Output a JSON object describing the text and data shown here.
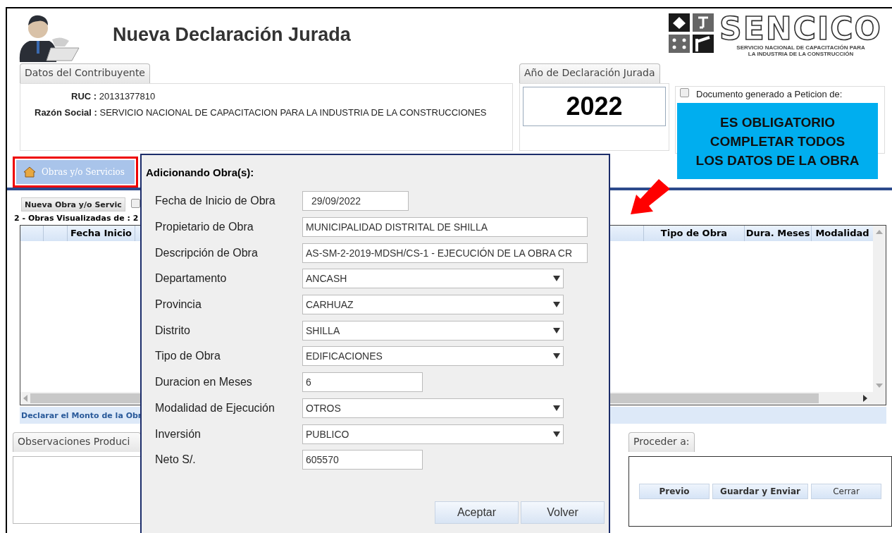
{
  "header": {
    "title": "Nueva Declaración Jurada",
    "logo": {
      "name": "SENCICO",
      "subtitle_lines": [
        "SERVICIO NACIONAL DE CAPACITACIÓN PARA",
        "LA INDUSTRIA DE LA CONSTRUCCIÓN"
      ]
    }
  },
  "contribuyente": {
    "tab": "Datos del Contribuyente",
    "fields": [
      {
        "label": "RUC :",
        "value": "20131377810"
      },
      {
        "label": "Razón Social :",
        "value": "SERVICIO NACIONAL DE CAPACITACION PARA LA INDUSTRIA DE LA CONSTRUCCIONES"
      }
    ]
  },
  "year": {
    "tab": "Año de Declaración Jurada",
    "value": "2022"
  },
  "peticion": {
    "label": "Documento generado a Peticion de:",
    "checked": false
  },
  "callout": {
    "lines": [
      "ES OBLIGATORIO",
      "COMPLETAR TODOS",
      "LOS DATOS DE LA OBRA"
    ]
  },
  "tabs": [
    {
      "label": "Obras y/o Servicios",
      "selected": true,
      "highlighted": true
    }
  ],
  "toolbar": {
    "button": "Nueva Obra y/o Servic",
    "checked": false
  },
  "count": "2 - Obras Visualizadas de : 2",
  "table": {
    "columns": [
      {
        "label": "Fecha Inicio"
      },
      {
        "label": "Tipo de Obra"
      },
      {
        "label": "Dura. Meses"
      },
      {
        "label": "Modalidad"
      }
    ]
  },
  "footer_link": "Declarar el Monto de la Obr",
  "observaciones": {
    "tab": "Observaciones Produci"
  },
  "proceder": {
    "tab": "Proceder a:",
    "buttons": [
      {
        "label": "Previo",
        "kind": "bold"
      },
      {
        "label": "Guardar y Enviar",
        "kind": "bold"
      },
      {
        "label": "Cerrar",
        "kind": "plain"
      }
    ]
  },
  "dialog": {
    "title": "Adicionando Obra(s):",
    "fields": [
      {
        "label": "Fecha de Inicio de Obra",
        "kind": "date",
        "value": "29/09/2022"
      },
      {
        "label": "Propietario de Obra",
        "kind": "text",
        "value": "MUNICIPALIDAD DISTRITAL DE SHILLA"
      },
      {
        "label": "Descripción de Obra",
        "kind": "text",
        "value": "AS-SM-2-2019-MDSH/CS-1 - EJECUCIÓN DE LA OBRA CR"
      },
      {
        "label": "Departamento",
        "kind": "select",
        "value": "ANCASH"
      },
      {
        "label": "Provincia",
        "kind": "select",
        "value": "CARHUAZ"
      },
      {
        "label": "Distrito",
        "kind": "select",
        "value": "SHILLA"
      },
      {
        "label": "Tipo de Obra",
        "kind": "select",
        "value": "EDIFICACIONES"
      },
      {
        "label": "Duracion en Meses",
        "kind": "number",
        "value": "6"
      },
      {
        "label": "Modalidad de Ejecución",
        "kind": "select",
        "value": "OTROS"
      },
      {
        "label": "Inversión",
        "kind": "select",
        "value": "PUBLICO"
      },
      {
        "label": "Neto S/.",
        "kind": "number",
        "value": "605570"
      }
    ],
    "buttons": [
      {
        "label": "Aceptar"
      },
      {
        "label": "Volver"
      }
    ]
  }
}
